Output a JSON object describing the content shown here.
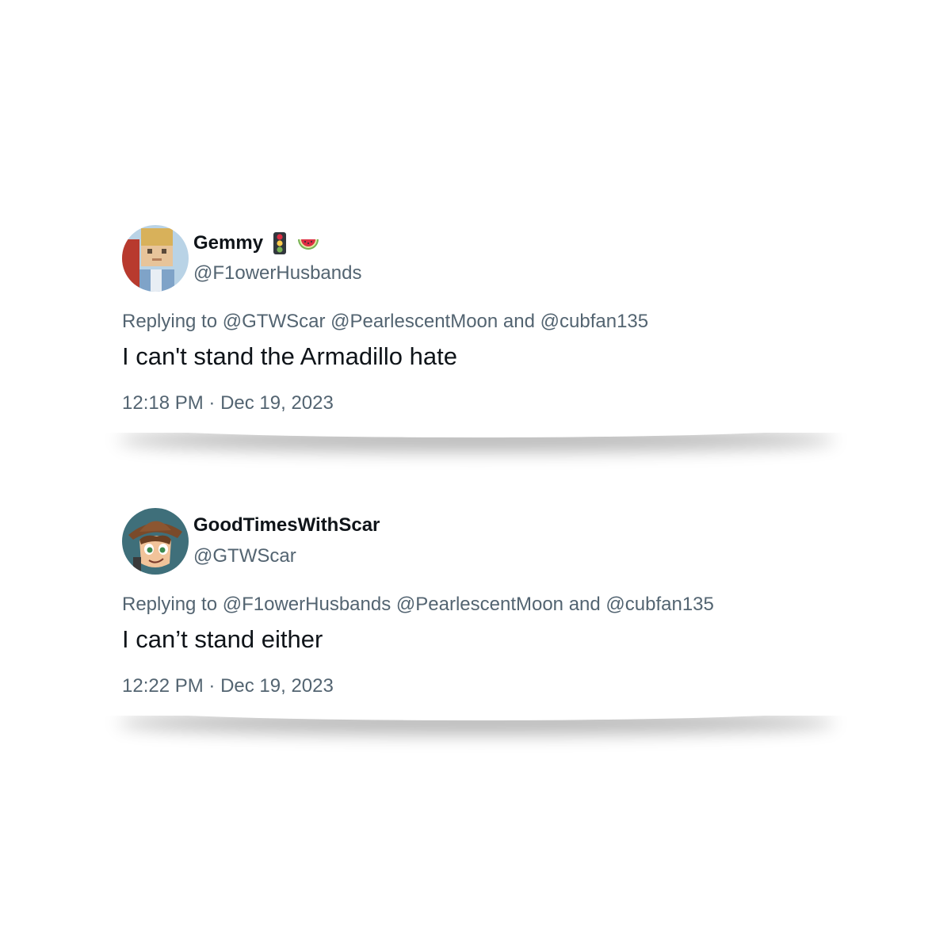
{
  "tweets": [
    {
      "display_name": "Gemmy",
      "name_icons": [
        "traffic-light-icon",
        "watermelon-icon"
      ],
      "handle": "@F1owerHusbands",
      "reply_prefix": "Replying to",
      "reply_mentions": "@GTWScar @PearlescentMoon",
      "reply_and": "and",
      "reply_last": "@cubfan135",
      "text": "I can't stand the Armadillo hate",
      "time": "12:18 PM",
      "separator": "·",
      "date": "Dec 19, 2023"
    },
    {
      "display_name": "GoodTimesWithScar",
      "name_icons": [],
      "handle": "@GTWScar",
      "reply_prefix": "Replying to",
      "reply_mentions": "@F1owerHusbands @PearlescentMoon",
      "reply_and": "and",
      "reply_last": "@cubfan135",
      "text": "I can’t stand either",
      "time": "12:22 PM",
      "separator": "·",
      "date": "Dec 19, 2023"
    }
  ],
  "colors": {
    "primary_text": "#0f1419",
    "secondary_text": "#536471",
    "background": "#ffffff"
  }
}
